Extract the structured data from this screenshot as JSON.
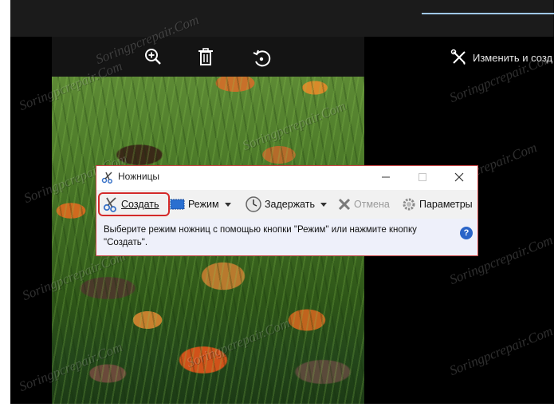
{
  "watermark": "Soringpcrepair.Com",
  "photos_app": {
    "edit_label": "Изменить и созд",
    "icons": [
      "zoom-in-icon",
      "delete-icon",
      "rotate-icon",
      "edit-create-icon"
    ]
  },
  "snipping_tool": {
    "title": "Ножницы",
    "toolbar": {
      "new_label": "Создать",
      "mode_label": "Режим",
      "delay_label": "Задержать",
      "cancel_label": "Отмена",
      "options_label": "Параметры"
    },
    "message": "Выберите режим ножниц с помощью кнопки \"Режим\" или нажмите кнопку \"Создать\".",
    "help_glyph": "?"
  },
  "colors": {
    "highlight": "#d42a2a",
    "window_border": "#c94545",
    "message_bg": "#eef0fa",
    "accent_line": "#9fc7ea"
  }
}
